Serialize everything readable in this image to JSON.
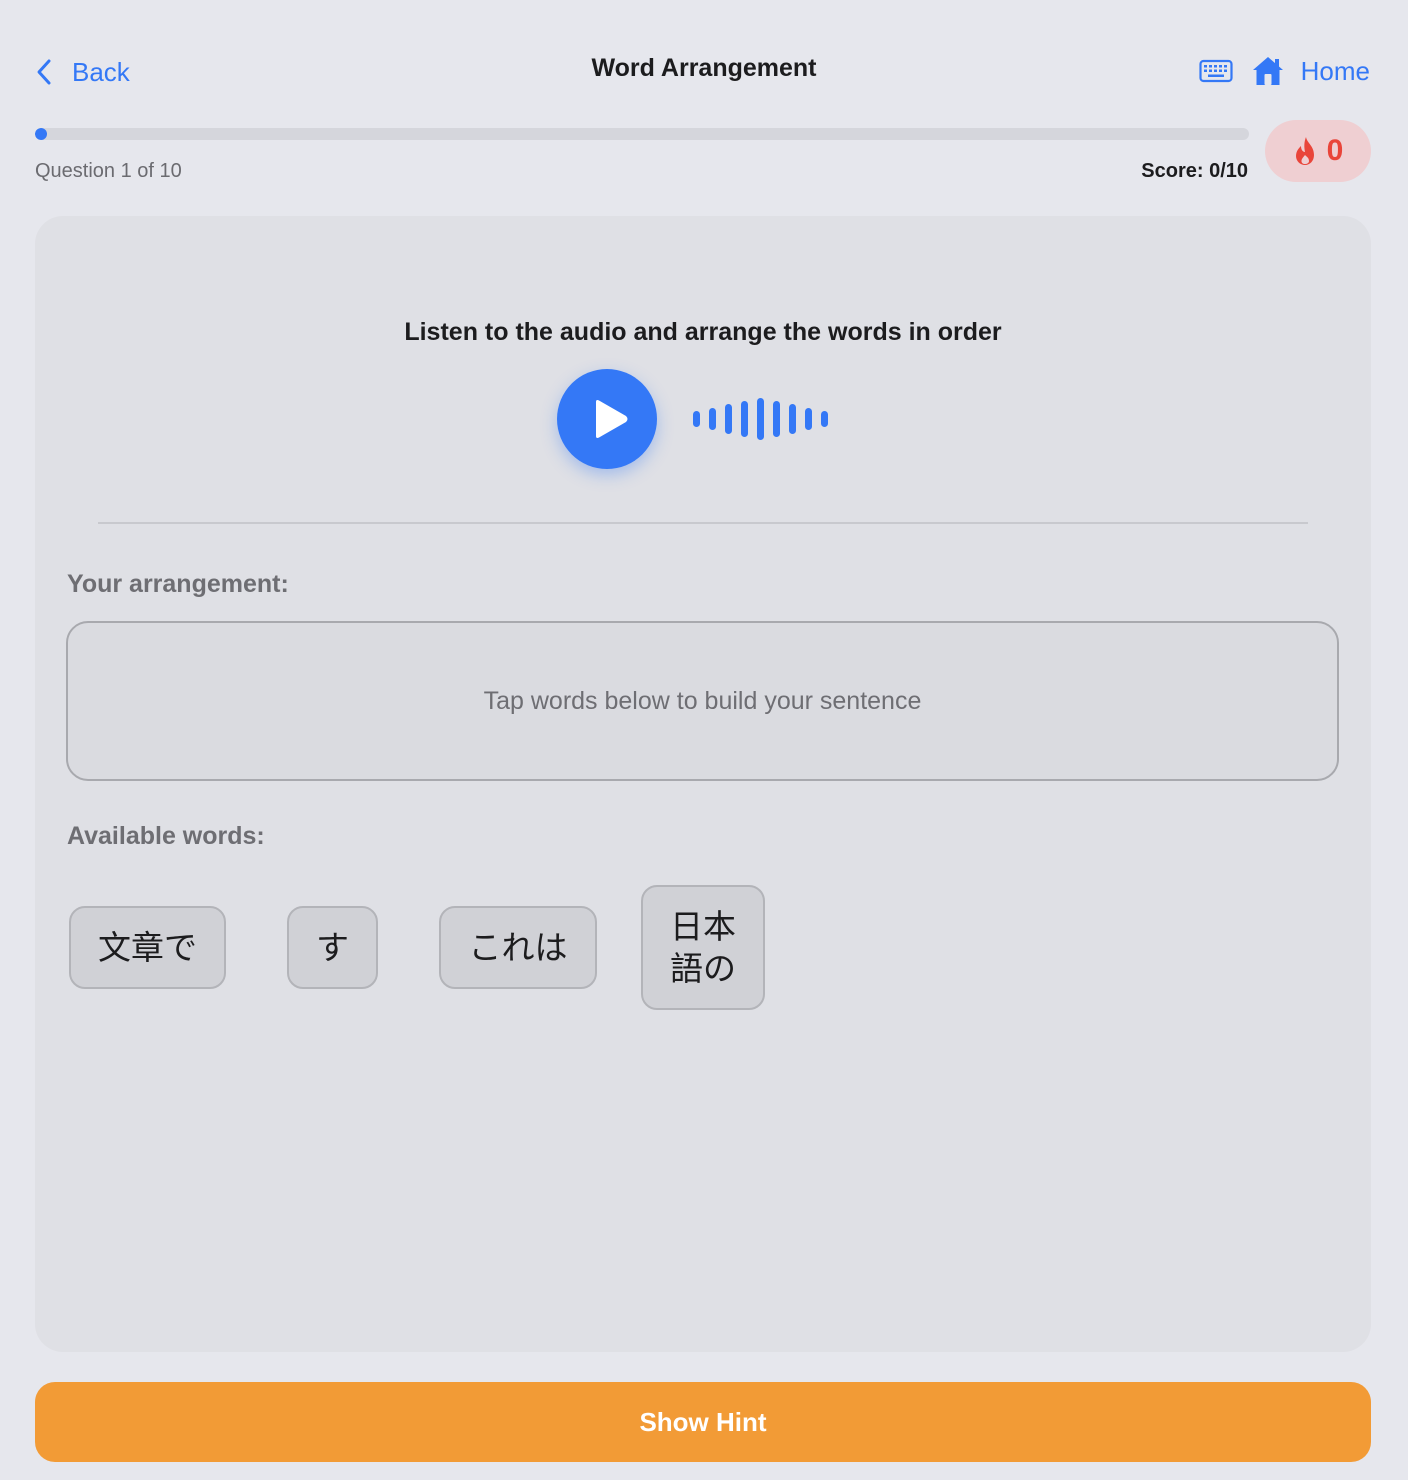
{
  "nav": {
    "back_label": "Back",
    "title": "Word Arrangement",
    "home_label": "Home",
    "icons": [
      "chevron-left-icon",
      "keyboard-icon",
      "house-icon"
    ]
  },
  "progress": {
    "question_text": "Question 1 of 10",
    "score_text": "Score: 0/10",
    "fraction": 0.01
  },
  "streak": {
    "count": "0",
    "icon": "flame-icon"
  },
  "exercise": {
    "instruction": "Listen to the audio and arrange the words in order",
    "arrangement_label": "Your arrangement:",
    "arrangement_placeholder": "Tap words below to build your sentence",
    "available_label": "Available words:",
    "words": [
      "文章で",
      "す",
      "これは",
      "日本語の"
    ]
  },
  "hint_button": "Show Hint",
  "colors": {
    "accent": "#3478f6",
    "hint": "#f29b36",
    "streak_bg": "#efcfd2",
    "streak_text": "#e9453a",
    "background": "#e6e7ed",
    "card": "#dfe0e5"
  }
}
